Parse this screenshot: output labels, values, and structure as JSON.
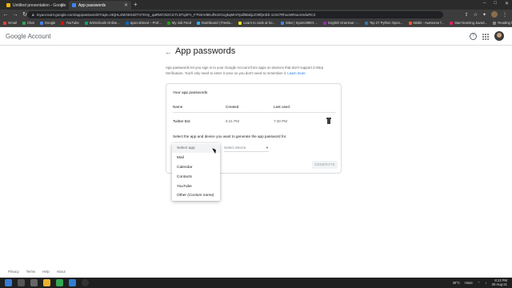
{
  "browser": {
    "tabs": [
      {
        "title": "Untitled presentation - Google",
        "favicon_color": "#f4b400"
      },
      {
        "title": "App passwords",
        "favicon_color": "#4285f4"
      }
    ],
    "url": "myaccount.google.com/apppasswords?rapt=AEjHL4MO6Xd4T47KHy_qaRWCNzCIcTL9Tq2Fn_F7NmV6EufN4zGcgkqMHiYpdl9lakjcZ39fpnEb-1zmi7RhuoWNuuVoduRC2",
    "bookmarks": [
      {
        "label": "Gmail",
        "color": "#ea4335"
      },
      {
        "label": "Chat",
        "color": "#34a853"
      },
      {
        "label": "Google",
        "color": "#4285f4"
      },
      {
        "label": "YouTube",
        "color": "#ff0000"
      },
      {
        "label": "W3Schools Online...",
        "color": "#04aa6d"
      },
      {
        "label": "ayan-ahmed – Prof...",
        "color": "#0a66c2"
      },
      {
        "label": "My Job Feed",
        "color": "#14a800"
      },
      {
        "label": "Dashboard | Freela...",
        "color": "#29b2fe"
      },
      {
        "label": "Learn to code at ho...",
        "color": "#f7df1e"
      },
      {
        "label": "Sites | Syam1988's ...",
        "color": "#4285f4"
      },
      {
        "label": "English Grammar -...",
        "color": "#9c27b0"
      },
      {
        "label": "Top 27 Python Open...",
        "color": "#3776ab"
      },
      {
        "label": "Misbit - Awesome f...",
        "color": "#ff5722"
      },
      {
        "label": "Start learning JavaS...",
        "color": "#e91e63"
      },
      {
        "label": "Reading list",
        "color": "#888888"
      }
    ]
  },
  "header": {
    "logo_google": "Google",
    "logo_account": "Account"
  },
  "page": {
    "title": "App passwords",
    "intro": "App passwords let you sign in to your Google Account from apps on devices that don't support 2-Step Verification. You'll only need to enter it once so you don't need to remember it.",
    "learn_more": "Learn more"
  },
  "card": {
    "title": "Your app passwords",
    "columns": [
      "Name",
      "Created",
      "Last used"
    ],
    "rows": [
      {
        "name": "Twitter Bot",
        "created": "6:21 PM",
        "last_used": "7:30 PM"
      }
    ],
    "select_label": "Select the app and device you want to generate the app password for.",
    "select_device": "Select device",
    "generate": "GENERATE"
  },
  "dropdown": {
    "placeholder": "Select app",
    "options": [
      "Mail",
      "Calendar",
      "Contacts",
      "YouTube"
    ],
    "other_label": "Other",
    "other_hint": "(Custom name)"
  },
  "footer": [
    "Privacy",
    "Terms",
    "Help",
    "About"
  ],
  "taskbar": {
    "temperature": "29°C",
    "weather": "Haze",
    "time": "8:13 PM",
    "date": "30-Aug-21"
  }
}
